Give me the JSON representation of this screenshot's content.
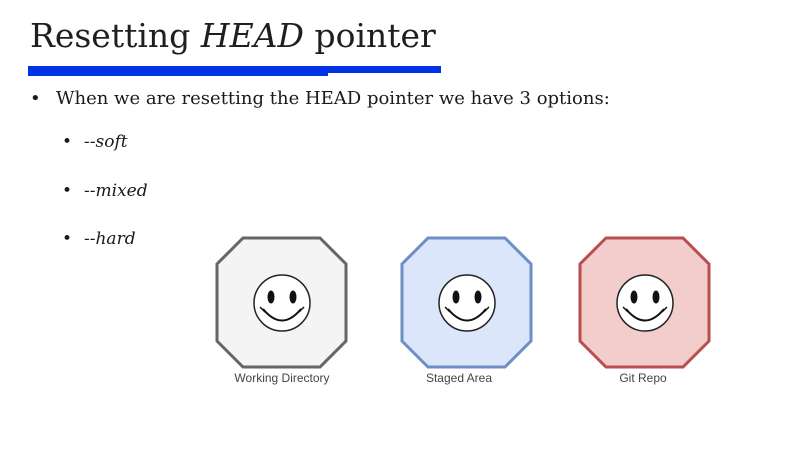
{
  "slide": {
    "title_prefix": "Resetting ",
    "title_emphasis": "HEAD",
    "title_suffix": " pointer",
    "accent_color": "#0033e6",
    "bullet_symbol": "•",
    "main_bullet": "When we are resetting the HEAD pointer we have 3 options:",
    "options": [
      "--soft",
      "--mixed",
      "--hard"
    ]
  },
  "diagram": {
    "stages": [
      {
        "label": "Working Directory",
        "fill": "#f4f4f4",
        "stroke": "#666666",
        "icon": "smiley-icon"
      },
      {
        "label": "Staged Area",
        "fill": "#dce6fb",
        "stroke": "#6f8fc4",
        "icon": "smiley-icon"
      },
      {
        "label": "Git Repo",
        "fill": "#f3cccc",
        "stroke": "#b84e4e",
        "icon": "smiley-icon"
      }
    ]
  }
}
